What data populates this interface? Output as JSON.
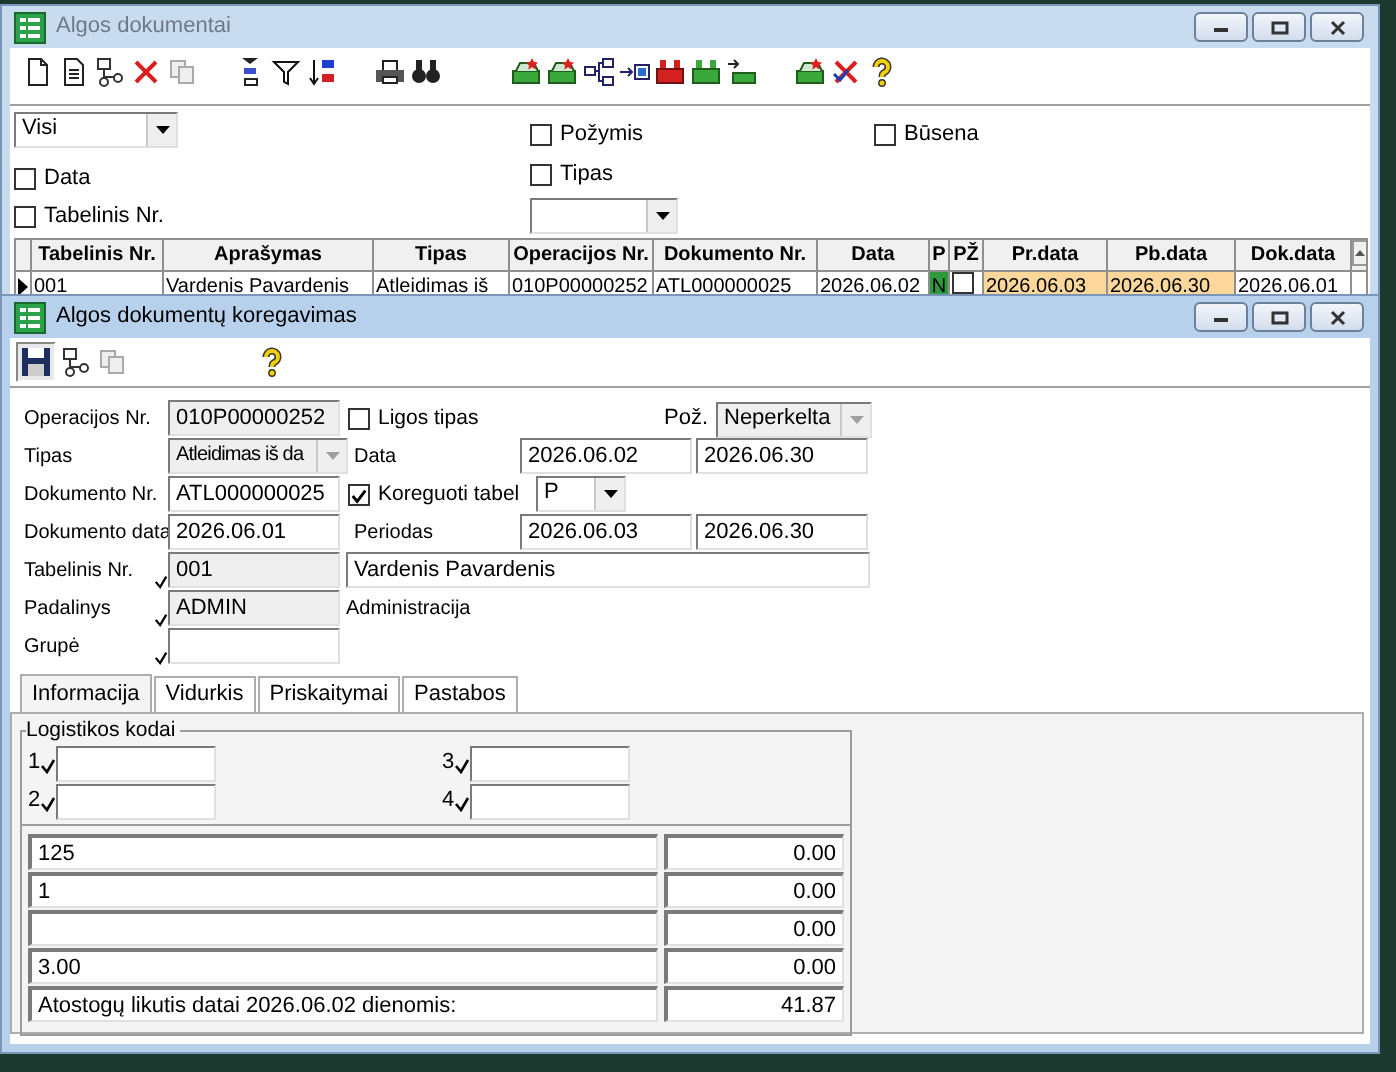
{
  "back_window": {
    "title": "Algos dokumentai",
    "filters": {
      "period": {
        "value": "Visi"
      },
      "left_checks": [
        {
          "label": "Data",
          "checked": false
        },
        {
          "label": "Tabelinis Nr.",
          "checked": false
        }
      ],
      "middle_checks": [
        {
          "label": "Požymis",
          "checked": false
        },
        {
          "label": "Tipas",
          "checked": false
        }
      ],
      "right_checks": [
        {
          "label": "Būsena",
          "checked": false
        }
      ]
    },
    "table": {
      "columns": [
        "Tabelinis Nr.",
        "Aprašymas",
        "Tipas",
        "Operacijos Nr.",
        "Dokumento Nr.",
        "Data",
        "P",
        "PŽ",
        "Pr.data",
        "Pb.data",
        "Dok.data"
      ],
      "rows": [
        {
          "selected": true,
          "cells": [
            {
              "kind": "text",
              "text": "001"
            },
            {
              "kind": "text",
              "text": "Vardenis Pavardenis"
            },
            {
              "kind": "text",
              "text": "Atleidimas iš"
            },
            {
              "kind": "text",
              "text": "010P00000252"
            },
            {
              "kind": "text",
              "text": "ATL000000025"
            },
            {
              "kind": "text",
              "text": "2026.06.02"
            },
            {
              "kind": "flag",
              "text": "N"
            },
            {
              "kind": "check",
              "checked": false
            },
            {
              "kind": "date",
              "text": "2026.06.03"
            },
            {
              "kind": "date",
              "text": "2026.06.30"
            },
            {
              "kind": "text",
              "text": "2026.06.01"
            }
          ]
        }
      ]
    }
  },
  "front_window": {
    "title": "Algos dokumentų koregavimas",
    "form": {
      "rows": [
        {
          "items": [
            {
              "kind": "label",
              "text": "Operacijos Nr."
            },
            {
              "kind": "field",
              "value": "010P00000252",
              "readonly": true,
              "lookup": false
            },
            {
              "kind": "checkbox",
              "label": "Ligos tipas",
              "checked": false
            },
            {
              "kind": "select",
              "label": "Pož.",
              "value": "Neperkelta",
              "disabled": true
            }
          ]
        },
        {
          "items": [
            {
              "kind": "label",
              "text": "Tipas"
            },
            {
              "kind": "select",
              "value": "Atleidimas iš da",
              "disabled": true
            },
            {
              "kind": "label",
              "text": "Data"
            },
            {
              "kind": "field",
              "value": "2026.06.02",
              "readonly": false
            },
            {
              "kind": "field",
              "value": "2026.06.30",
              "readonly": false
            }
          ]
        },
        {
          "items": [
            {
              "kind": "label",
              "text": "Dokumento Nr."
            },
            {
              "kind": "field",
              "value": "ATL000000025",
              "readonly": false,
              "lookup": false
            },
            {
              "kind": "checkbox",
              "label": "Koreguoti tabel",
              "checked": true
            },
            {
              "kind": "select",
              "value": "P",
              "disabled": false
            }
          ]
        },
        {
          "items": [
            {
              "kind": "label",
              "text": "Dokumento data"
            },
            {
              "kind": "field",
              "value": "2026.06.01",
              "readonly": false,
              "lookup": false
            },
            {
              "kind": "label",
              "text": "Periodas"
            },
            {
              "kind": "field",
              "value": "2026.06.03",
              "readonly": false
            },
            {
              "kind": "field",
              "value": "2026.06.30",
              "readonly": false
            }
          ]
        },
        {
          "items": [
            {
              "kind": "label",
              "text": "Tabelinis Nr."
            },
            {
              "kind": "field",
              "value": "001",
              "readonly": true,
              "lookup": true
            },
            {
              "kind": "field",
              "value": "Vardenis Pavardenis",
              "readonly": false
            }
          ]
        },
        {
          "items": [
            {
              "kind": "label",
              "text": "Padalinys"
            },
            {
              "kind": "field",
              "value": "ADMIN",
              "readonly": true,
              "lookup": true
            },
            {
              "kind": "text",
              "text": "Administracija"
            }
          ]
        },
        {
          "items": [
            {
              "kind": "label",
              "text": "Grupė"
            },
            {
              "kind": "field",
              "readonly": false,
              "lookup": true
            }
          ]
        }
      ]
    },
    "tabs": [
      {
        "label": "Informacija",
        "selected": true
      },
      {
        "label": "Vidurkis",
        "selected": false
      },
      {
        "label": "Priskaitymai",
        "selected": false
      },
      {
        "label": "Pastabos",
        "selected": false
      }
    ],
    "logistics": {
      "title": "Logistikos kodai",
      "codes": [
        {
          "label": "1",
          "lookup": true
        },
        {
          "label": "3",
          "lookup": true
        },
        {
          "label": "2",
          "lookup": true
        },
        {
          "label": "4",
          "lookup": true
        }
      ]
    },
    "summary_rows": [
      {
        "label": "125",
        "value": "0.00"
      },
      {
        "label": "1",
        "value": "0.00"
      },
      {
        "value": "0.00"
      },
      {
        "label": "3.00",
        "value": "0.00"
      },
      {
        "label": "Atostogų likutis datai 2026.06.02 dienomis:",
        "value": "41.87"
      }
    ]
  }
}
